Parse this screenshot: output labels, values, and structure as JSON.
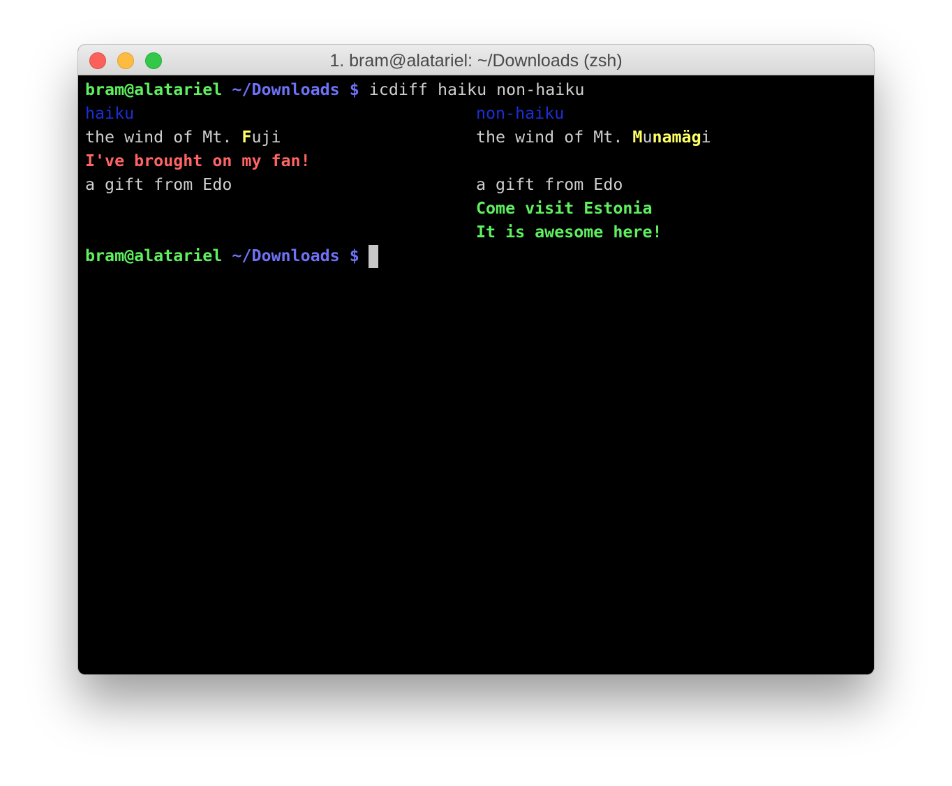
{
  "window": {
    "title": "1. bram@alatariel: ~/Downloads (zsh)",
    "controls": {
      "close_color": "#fc605b",
      "minimize_color": "#fdbc40",
      "zoom_color": "#34c84a"
    }
  },
  "colors": {
    "background": "#000000",
    "text": "#cfcfcf",
    "prompt_user": "#5ff05f",
    "prompt_path": "#6e72f7",
    "header": "#1c2fd6",
    "changed": "#ffff66",
    "removed": "#ff6565",
    "added": "#5ff05f"
  },
  "terminal": {
    "prompt": {
      "user_host": "bram@alatariel",
      "path": "~/Downloads",
      "symbol": "$"
    },
    "command": "icdiff haiku non-haiku",
    "diff": {
      "left_header": "haiku",
      "right_header": "non-haiku",
      "left_line1_prefix": "the wind of Mt. ",
      "left_line1_changed": "F",
      "left_line1_suffix": "uji",
      "right_line1_prefix": "the wind of Mt. ",
      "right_line1_changed_a": "M",
      "right_line1_mid": "u",
      "right_line1_changed_b": "namäg",
      "right_line1_suffix": "i",
      "left_removed": "I've brought on my fan!",
      "left_line3": "a gift from Edo",
      "right_line3": "a gift from Edo",
      "right_added_1": "Come visit Estonia",
      "right_added_2": "It is awesome here!"
    }
  }
}
